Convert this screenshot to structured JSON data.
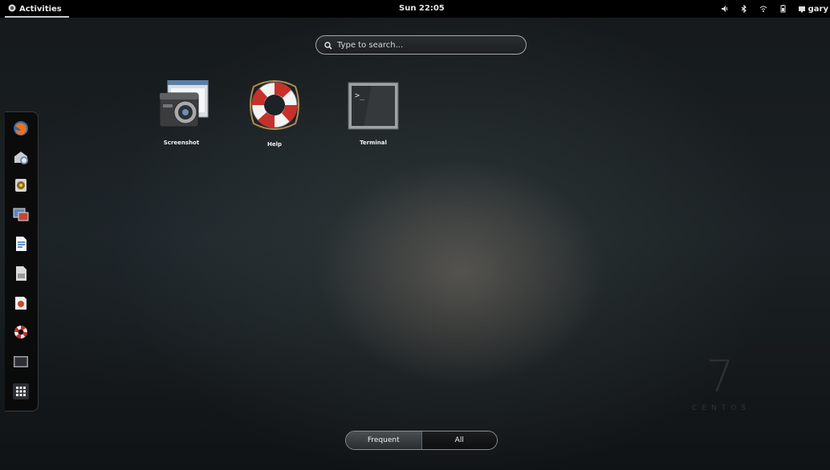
{
  "topbar": {
    "activities_label": "Activities",
    "clock": "Sun 22:05",
    "user_name": "gary",
    "tray_icons": [
      "volume-icon",
      "bluetooth-icon",
      "wifi-icon",
      "battery-icon",
      "user-icon"
    ]
  },
  "search": {
    "placeholder": "Type to search..."
  },
  "apps": [
    {
      "label": "Screenshot",
      "icon": "screenshot-icon"
    },
    {
      "label": "Help",
      "icon": "help-lifebuoy-icon"
    },
    {
      "label": "Terminal",
      "icon": "terminal-icon"
    }
  ],
  "dash": {
    "items": [
      "firefox-icon",
      "evolution-mail-icon",
      "rhythmbox-icon",
      "shotwell-icon",
      "writer-document-icon",
      "files-icon",
      "software-install-icon",
      "help-icon",
      "terminal-icon",
      "show-applications-icon"
    ]
  },
  "view_switch": {
    "frequent_label": "Frequent",
    "all_label": "All"
  },
  "watermark": {
    "number": "7",
    "word": "CENTOS"
  },
  "colors": {
    "panel": "#000000",
    "text": "#ffffff",
    "help_red": "#c8302a"
  }
}
